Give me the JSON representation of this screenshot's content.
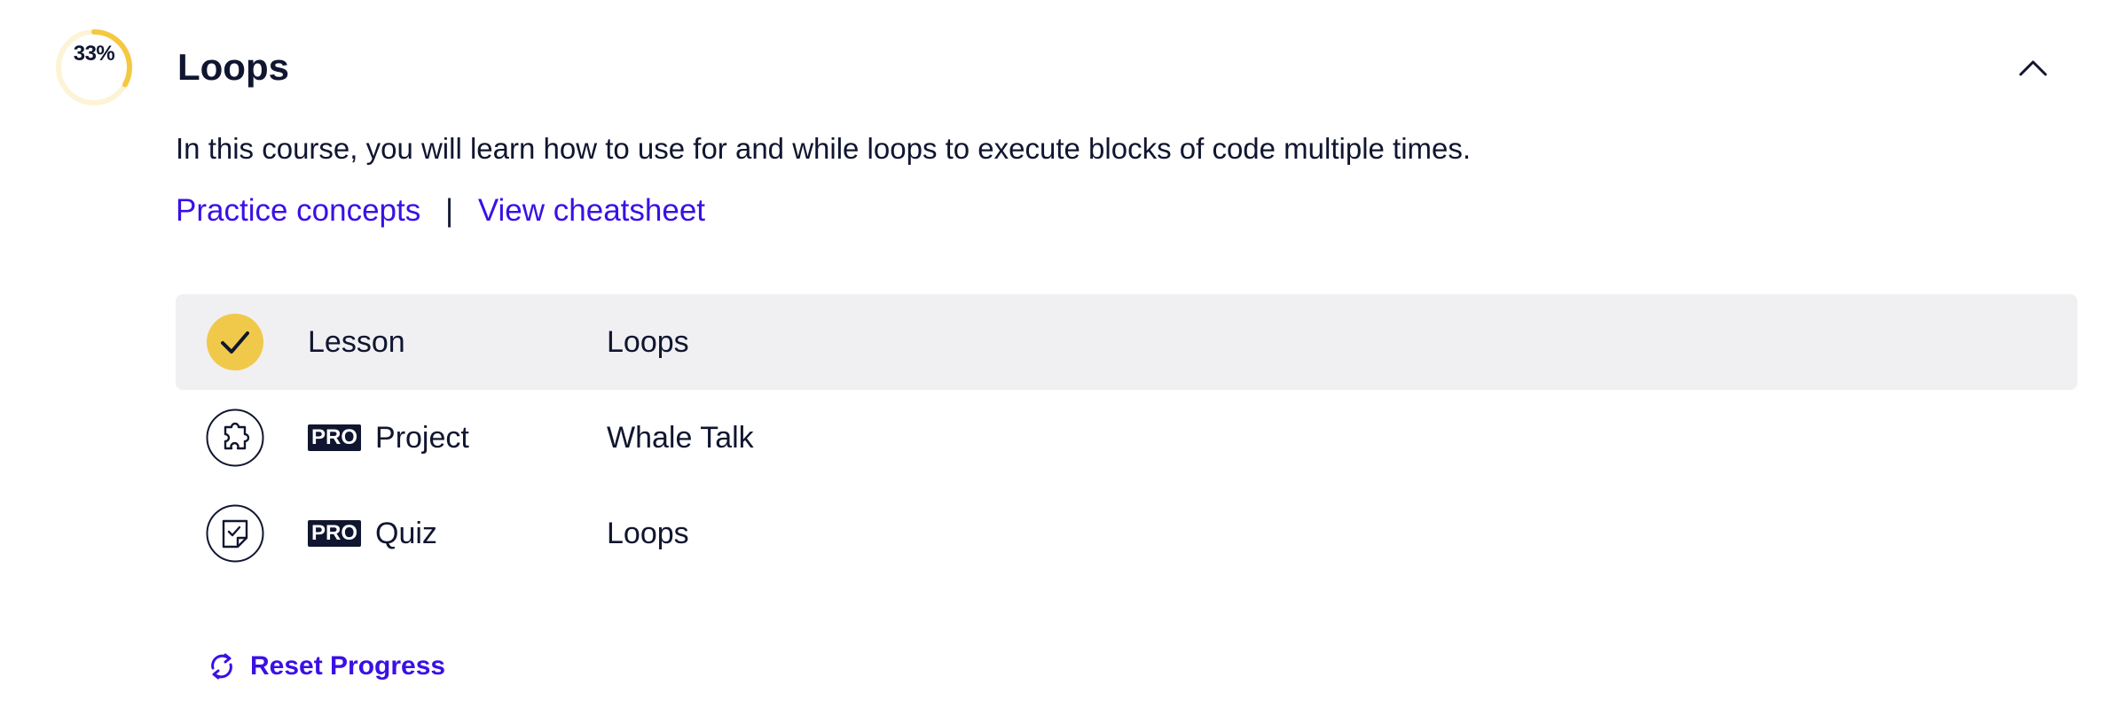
{
  "module": {
    "progress_percent": 33,
    "progress_label": "33%",
    "title": "Loops",
    "description": "In this course, you will learn how to use for and while loops to execute blocks of code multiple times.",
    "links": {
      "practice": "Practice concepts",
      "separator": "|",
      "cheatsheet": "View cheatsheet"
    }
  },
  "items": [
    {
      "icon": "check-circle-icon",
      "pro": false,
      "kind": "Lesson",
      "name": "Loops",
      "completed": true
    },
    {
      "icon": "puzzle-icon",
      "pro": true,
      "pro_label": "PRO",
      "kind": "Project",
      "name": "Whale Talk",
      "completed": false
    },
    {
      "icon": "quiz-note-icon",
      "pro": true,
      "pro_label": "PRO",
      "kind": "Quiz",
      "name": "Loops",
      "completed": false
    }
  ],
  "reset_label": "Reset Progress",
  "colors": {
    "accent_link": "#3a10e5",
    "progress_yellow": "#f5c842",
    "completed_yellow": "#f0c94b",
    "text_dark": "#10162f",
    "active_row_bg": "#f0f0f2"
  }
}
